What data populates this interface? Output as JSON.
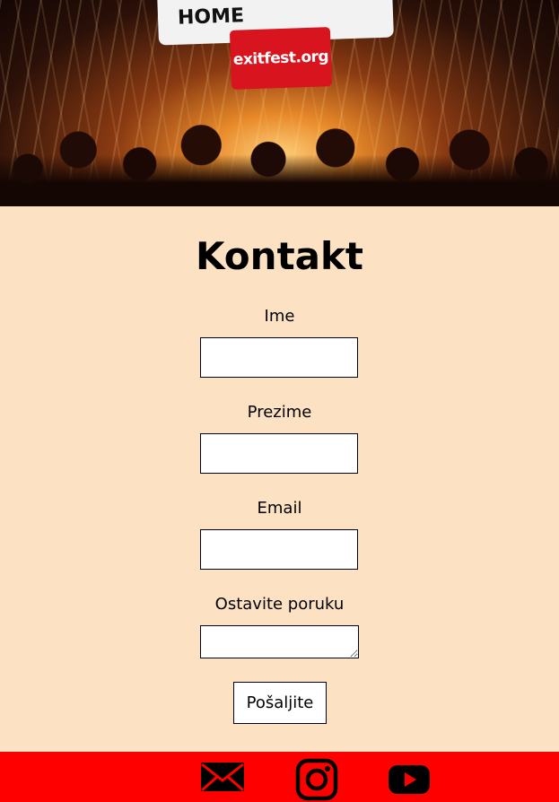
{
  "hero": {
    "banner_text": "HOME",
    "logo_text": "exitfest.org"
  },
  "page": {
    "title": "Kontakt"
  },
  "form": {
    "first_name_label": "Ime",
    "last_name_label": "Prezime",
    "email_label": "Email",
    "message_label": "Ostavite poruku",
    "first_name_value": "",
    "last_name_value": "",
    "email_value": "",
    "message_value": "",
    "submit_label": "Pošaljite"
  },
  "footer": {
    "icons": [
      "mail-icon",
      "instagram-icon",
      "youtube-icon"
    ],
    "background": "#ff0000"
  },
  "colors": {
    "page_background": "#fce2c3",
    "footer": "#ff0000",
    "logo_red": "#d8141f"
  }
}
